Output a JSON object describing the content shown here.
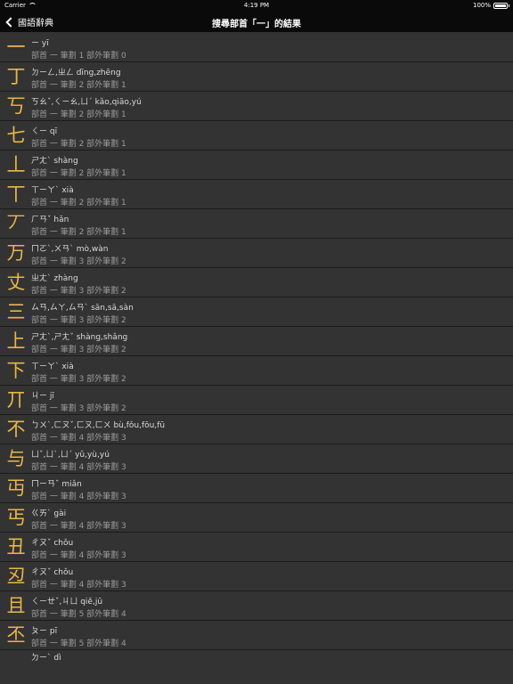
{
  "status_bar": {
    "carrier": "Carrier",
    "time": "4:19 PM",
    "battery": "100%",
    "wifi_icon": "wifi-icon",
    "battery_icon": "battery-icon"
  },
  "nav": {
    "back_label": "國語辭典",
    "title": "搜尋部首「一」的結果"
  },
  "colors": {
    "background": "#333333",
    "bar": "#0a0a0a",
    "glyph": "#e8b64a"
  },
  "entries": [
    {
      "char": "一",
      "reading": "ㄧ  yī",
      "info": "部首 一  筆劃 1  部外筆劃 0"
    },
    {
      "char": "丁",
      "reading": "ㄉㄧㄥ,ㄓㄥ  dīng,zhēng",
      "info": "部首 一  筆劃 2  部外筆劃 1"
    },
    {
      "char": "丂",
      "reading": "ㄎㄠˇ,ㄑㄧㄠ,ㄩˊ  kǎo,qiāo,yú",
      "info": "部首 一  筆劃 2  部外筆劃 1"
    },
    {
      "char": "七",
      "reading": "ㄑㄧ  qī",
      "info": "部首 一  筆劃 2  部外筆劃 1"
    },
    {
      "char": "丄",
      "reading": "ㄕㄤˋ  shàng",
      "info": "部首 一  筆劃 2  部外筆劃 1"
    },
    {
      "char": "丅",
      "reading": "ㄒㄧㄚˋ  xià",
      "info": "部首 一  筆劃 2  部外筆劃 1"
    },
    {
      "char": "丆",
      "reading": "ㄏㄢˇ  hǎn",
      "info": "部首 一  筆劃 2  部外筆劃 1"
    },
    {
      "char": "万",
      "reading": "ㄇㄛˋ,ㄨㄢˋ  mò,wàn",
      "info": "部首 一  筆劃 3  部外筆劃 2"
    },
    {
      "char": "丈",
      "reading": "ㄓㄤˋ  zhàng",
      "info": "部首 一  筆劃 3  部外筆劃 2"
    },
    {
      "char": "三",
      "reading": "ㄙㄢ,ㄙㄚ,ㄙㄢˋ  sān,sā,sàn",
      "info": "部首 一  筆劃 3  部外筆劃 2"
    },
    {
      "char": "上",
      "reading": "ㄕㄤˋ,ㄕㄤˇ  shàng,shǎng",
      "info": "部首 一  筆劃 3  部外筆劃 2"
    },
    {
      "char": "下",
      "reading": "ㄒㄧㄚˋ  xià",
      "info": "部首 一  筆劃 3  部外筆劃 2"
    },
    {
      "char": "丌",
      "reading": "ㄐㄧ  jī",
      "info": "部首 一  筆劃 3  部外筆劃 2"
    },
    {
      "char": "不",
      "reading": "ㄅㄨˋ,ㄈㄡˇ,ㄈㄡ,ㄈㄨ  bù,fǒu,fōu,fū",
      "info": "部首 一  筆劃 4  部外筆劃 3"
    },
    {
      "char": "与",
      "reading": "ㄩˇ,ㄩˋ,ㄩˊ  yǔ,yù,yú",
      "info": "部首 一  筆劃 4  部外筆劃 3"
    },
    {
      "char": "丏",
      "reading": "ㄇㄧㄢˇ  miǎn",
      "info": "部首 一  筆劃 4  部外筆劃 3"
    },
    {
      "char": "丐",
      "reading": "ㄍㄞˋ  gài",
      "info": "部首 一  筆劃 4  部外筆劃 3"
    },
    {
      "char": "丑",
      "reading": "ㄔㄡˇ  chǒu",
      "info": "部首 一  筆劃 4  部外筆劃 3"
    },
    {
      "char": "丒",
      "reading": "ㄔㄡˇ  chǒu",
      "info": "部首 一  筆劃 4  部外筆劃 3"
    },
    {
      "char": "且",
      "reading": "ㄑㄧㄝˇ,ㄐㄩ  qiě,jū",
      "info": "部首 一  筆劃 5  部外筆劃 4"
    },
    {
      "char": "丕",
      "reading": "ㄆㄧ  pī",
      "info": "部首 一  筆劃 5  部外筆劃 4"
    }
  ],
  "partial_entry": {
    "reading": "ㄉㄧˋ  dì"
  }
}
